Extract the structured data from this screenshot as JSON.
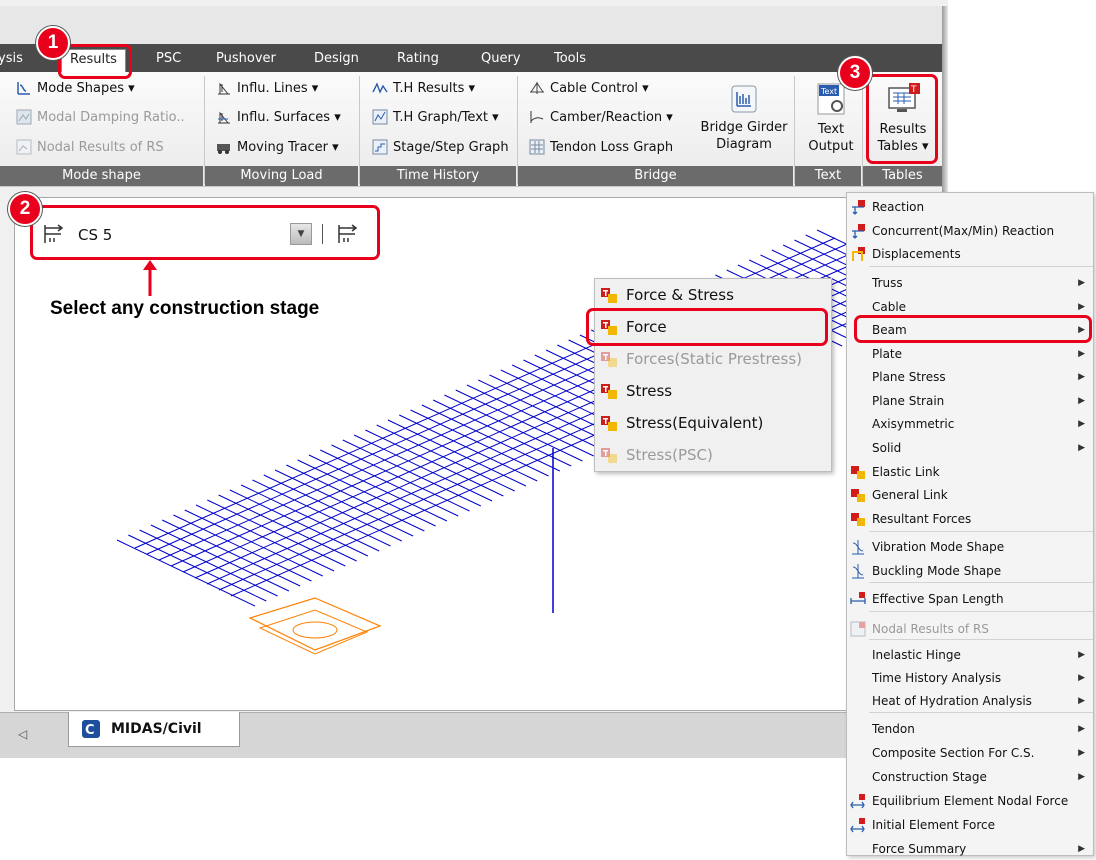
{
  "tabs": {
    "analysis_partial": "ysis",
    "results": "Results",
    "psc": "PSC",
    "pushover": "Pushover",
    "design": "Design",
    "rating": "Rating",
    "query": "Query",
    "tools": "Tools"
  },
  "ribbon": {
    "mode_shape": {
      "mode_shapes": "Mode Shapes ▾",
      "modal_damping": "Modal Damping Ratio..",
      "nodal_results": "Nodal Results of RS",
      "group_label": "Mode shape"
    },
    "moving_load": {
      "influ_lines": "Influ. Lines ▾",
      "influ_surfaces": "Influ. Surfaces ▾",
      "moving_tracer": "Moving Tracer ▾",
      "group_label": "Moving Load"
    },
    "time_history": {
      "th_results": "T.H Results ▾",
      "th_graph": "T.H Graph/Text ▾",
      "stage_step": "Stage/Step Graph",
      "group_label": "Time History"
    },
    "bridge": {
      "cable_control": "Cable Control ▾",
      "camber_reaction": "Camber/Reaction ▾",
      "tendon_loss": "Tendon Loss Graph",
      "bridge_girder_1": "Bridge Girder",
      "bridge_girder_2": "Diagram",
      "group_label": "Bridge"
    },
    "text": {
      "text_output_1": "Text",
      "text_output_2": "Output",
      "group_label": "Text",
      "icon_text": "Text"
    },
    "tables": {
      "results_tables_1": "Results",
      "results_tables_2": "Tables ▾",
      "group_label": "Tables"
    }
  },
  "stage_selector": {
    "value": "CS 5"
  },
  "caption": "Select any construction stage",
  "badges": [
    "1",
    "2",
    "3"
  ],
  "context_menu": [
    {
      "label": "Force & Stress",
      "enabled": true
    },
    {
      "label": "Force",
      "enabled": true
    },
    {
      "label": "Forces(Static Prestress)",
      "enabled": false
    },
    {
      "label": "Stress",
      "enabled": true
    },
    {
      "label": "Stress(Equivalent)",
      "enabled": true
    },
    {
      "label": "Stress(PSC)",
      "enabled": false
    }
  ],
  "results_menu": [
    {
      "label": "Reaction"
    },
    {
      "label": "Concurrent(Max/Min) Reaction"
    },
    {
      "label": "Displacements"
    },
    {
      "label": "Truss",
      "submenu": true
    },
    {
      "label": "Cable",
      "submenu": true
    },
    {
      "label": "Beam",
      "submenu": true
    },
    {
      "label": "Plate",
      "submenu": true
    },
    {
      "label": "Plane Stress",
      "submenu": true
    },
    {
      "label": "Plane Strain",
      "submenu": true
    },
    {
      "label": "Axisymmetric",
      "submenu": true
    },
    {
      "label": "Solid",
      "submenu": true
    },
    {
      "label": "Elastic Link"
    },
    {
      "label": "General Link"
    },
    {
      "label": "Resultant Forces"
    },
    {
      "label": "Vibration Mode Shape"
    },
    {
      "label": "Buckling Mode Shape"
    },
    {
      "label": "Effective Span Length"
    },
    {
      "label": "Nodal Results of RS",
      "enabled": false
    },
    {
      "label": "Inelastic Hinge",
      "submenu": true
    },
    {
      "label": "Time History Analysis",
      "submenu": true
    },
    {
      "label": "Heat of Hydration Analysis",
      "submenu": true
    },
    {
      "label": "Tendon",
      "submenu": true
    },
    {
      "label": "Composite Section For C.S.",
      "submenu": true
    },
    {
      "label": "Construction Stage",
      "submenu": true
    },
    {
      "label": "Equilibrium Element Nodal Force"
    },
    {
      "label": "Initial Element Force"
    },
    {
      "label": "Force Summary",
      "submenu": true
    }
  ],
  "view_tab": {
    "label": "MIDAS/Civil"
  },
  "colors": {
    "highlight": "#e8001c",
    "model_lines": "#0000cc",
    "support": "#ff8000",
    "tab_bar": "#4a4a4a"
  }
}
